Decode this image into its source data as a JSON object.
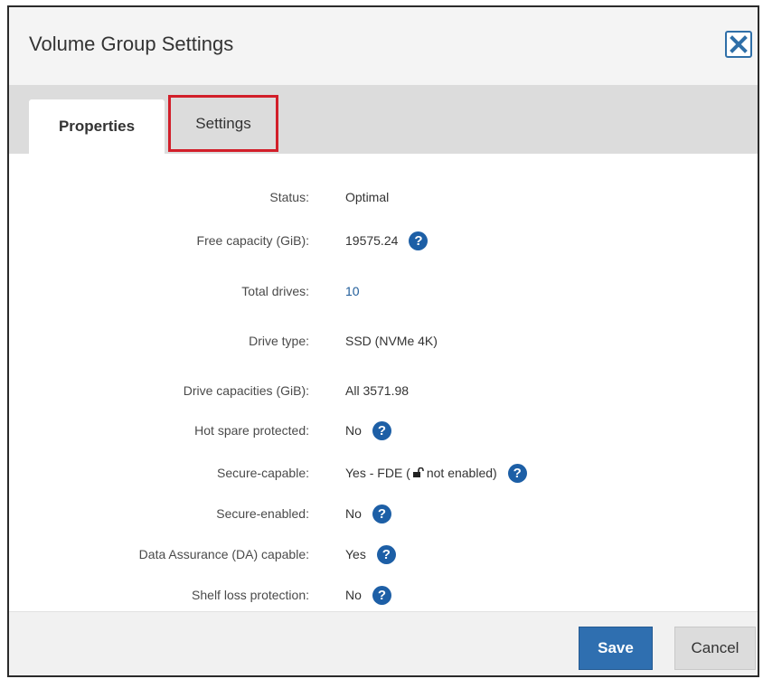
{
  "dialog": {
    "title": "Volume Group Settings",
    "close_icon": "close-icon"
  },
  "tabs": [
    {
      "label": "Properties",
      "active": true
    },
    {
      "label": "Settings",
      "active": false,
      "highlighted": true
    }
  ],
  "properties": {
    "status": {
      "label": "Status:",
      "value": "Optimal"
    },
    "free_capacity": {
      "label": "Free capacity (GiB):",
      "value": "19575.24"
    },
    "total_drives": {
      "label": "Total drives:",
      "value": "10"
    },
    "drive_type": {
      "label": "Drive type:",
      "value": "SSD (NVMe 4K)"
    },
    "drive_capacities": {
      "label": "Drive capacities (GiB):",
      "value": "All 3571.98"
    },
    "hot_spare": {
      "label": "Hot spare protected:",
      "value": "No"
    },
    "secure_capable": {
      "label": "Secure-capable:",
      "value_prefix": "Yes - FDE (",
      "value_suffix": " not enabled)"
    },
    "secure_enabled": {
      "label": "Secure-enabled:",
      "value": "No"
    },
    "da_capable": {
      "label": "Data Assurance (DA) capable:",
      "value": "Yes"
    },
    "shelf_loss": {
      "label": "Shelf loss protection:",
      "value": "No"
    }
  },
  "help_glyph": "?",
  "footer": {
    "save_label": "Save",
    "cancel_label": "Cancel"
  },
  "colors": {
    "accent": "#2f6fb0",
    "help_icon": "#1d5fa6",
    "highlight": "#d21f2a"
  }
}
